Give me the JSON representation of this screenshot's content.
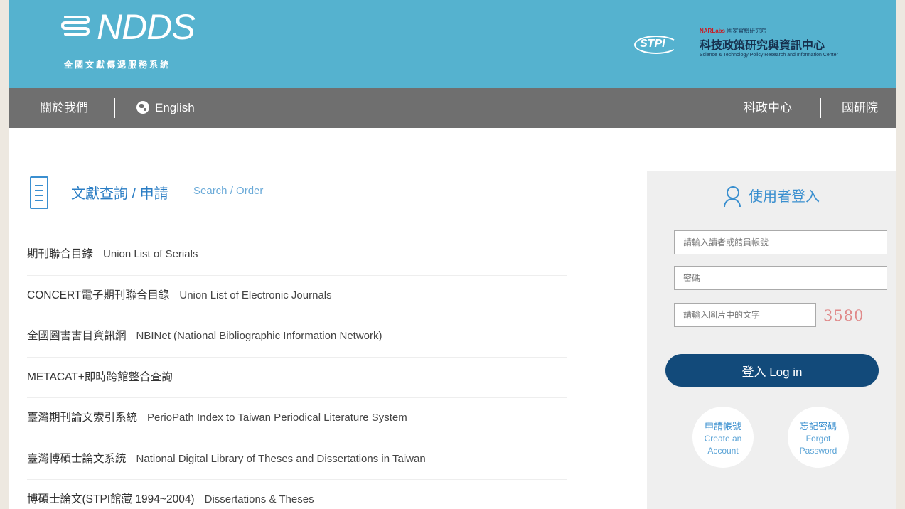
{
  "header": {
    "logo_text": "NDDS",
    "logo_subtitle": "全國文獻傳遞服務系統",
    "partner_small": "國家實驗研究院",
    "partner_small_brand": "NARLabs",
    "partner_name": "科技政策研究與資訊中心",
    "partner_eng": "Science & Technology Policy Research and Information Center",
    "partner_logo": "STPI"
  },
  "nav": {
    "about": "關於我們",
    "english": "English",
    "stpi": "科政中心",
    "narl": "國研院"
  },
  "section": {
    "title": "文獻查詢 / 申請",
    "subtitle": "Search / Order"
  },
  "databases": [
    {
      "zh": "期刊聯合目錄",
      "en": "Union List of Serials"
    },
    {
      "zh": "CONCERT電子期刊聯合目錄",
      "en": "Union List of Electronic Journals"
    },
    {
      "zh": "全國圖書書目資訊網",
      "en": "NBINet (National Bibliographic Information Network)"
    },
    {
      "zh": "METACAT+即時跨館整合查詢",
      "en": ""
    },
    {
      "zh": "臺灣期刊論文索引系統",
      "en": "PerioPath Index to Taiwan Periodical Literature System"
    },
    {
      "zh": "臺灣博碩士論文系統",
      "en": "National Digital Library of Theses and Dissertations in Taiwan"
    },
    {
      "zh": "博碩士論文(STPI館藏 1994~2004)",
      "en": "Dissertations & Theses"
    }
  ],
  "login": {
    "title": "使用者登入",
    "account_placeholder": "請輸入讀者或館員帳號",
    "password_placeholder": "密碼",
    "captcha_placeholder": "請輸入圖片中的文字",
    "captcha_code": "3580",
    "login_button": "登入 Log in",
    "create_zh": "申請帳號",
    "create_en_1": "Create an",
    "create_en_2": "Account",
    "forgot_zh": "忘記密碼",
    "forgot_en_1": "Forgot",
    "forgot_en_2": "Password"
  },
  "colors": {
    "header_bg": "#55b2cf",
    "nav_bg": "#6f6f6f",
    "accent": "#2a7dc4",
    "login_button": "#124a7a",
    "captcha": "#e08a8a"
  }
}
